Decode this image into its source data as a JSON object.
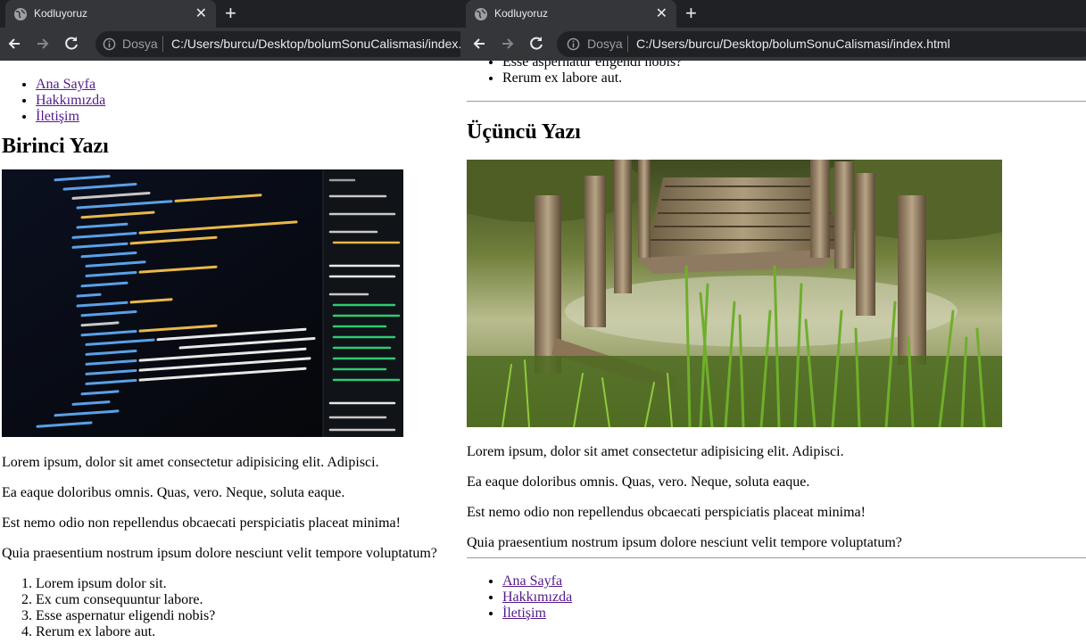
{
  "browser_left": {
    "tab_title": "Kodluyoruz",
    "scheme": "Dosya",
    "url": "C:/Users/burcu/Desktop/bolumSonuCalismasi/index.html"
  },
  "browser_right": {
    "tab_title": "Kodluyoruz",
    "scheme": "Dosya",
    "url": "C:/Users/burcu/Desktop/bolumSonuCalismasi/index.html"
  },
  "nav": [
    "Ana Sayfa",
    "Hakkımızda",
    "İletişim"
  ],
  "post1": {
    "title": "Birinci Yazı",
    "paragraphs": [
      "Lorem ipsum, dolor sit amet consectetur adipisicing elit. Adipisci.",
      "Ea eaque doloribus omnis. Quas, vero. Neque, soluta eaque.",
      "Est nemo odio non repellendus obcaecati perspiciatis placeat minima!",
      "Quia praesentium nostrum ipsum dolore nesciunt velit tempore voluptatum?"
    ],
    "list": [
      "Lorem ipsum dolor sit.",
      "Ex cum consequuntur labore.",
      "Esse aspernatur eligendi nobis?",
      "Rerum ex labore aut."
    ]
  },
  "post3": {
    "list_tail": [
      "Esse aspernatur eligendi nobis?",
      "Rerum ex labore aut."
    ],
    "title": "Üçüncü Yazı",
    "paragraphs": [
      "Lorem ipsum, dolor sit amet consectetur adipisicing elit. Adipisci.",
      "Ea eaque doloribus omnis. Quas, vero. Neque, soluta eaque.",
      "Est nemo odio non repellendus obcaecati perspiciatis placeat minima!",
      "Quia praesentium nostrum ipsum dolore nesciunt velit tempore voluptatum?"
    ]
  },
  "icons": {
    "tab_favicon": "globe-icon",
    "tab_close": "close-icon",
    "new_tab": "plus-icon",
    "back": "arrow-left-icon",
    "forward": "arrow-right-icon",
    "reload": "reload-icon",
    "site_info": "info-icon"
  },
  "colors": {
    "chrome_bg": "#202124",
    "toolbar_bg": "#35363a",
    "visited_link": "#551a8b"
  }
}
